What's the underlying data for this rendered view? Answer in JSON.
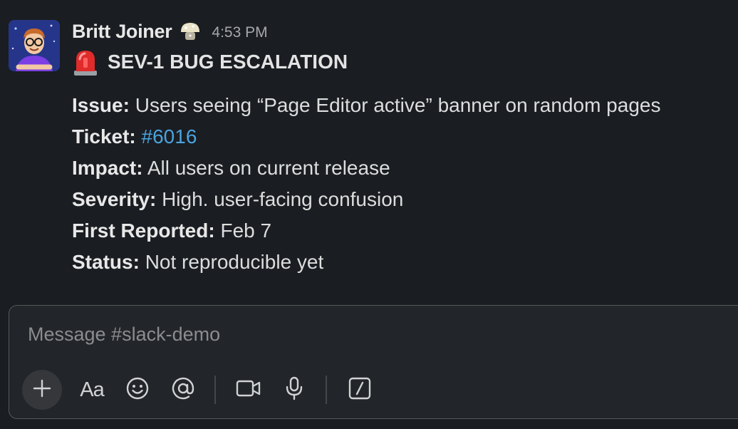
{
  "message": {
    "author": "Britt Joiner",
    "timestamp": "4:53 PM",
    "status_emoji": "mushroom-status-icon",
    "title_emoji": "rotating-light-icon",
    "title": "SEV-1 BUG ESCALATION",
    "details": [
      {
        "label": "Issue:",
        "value": "Users seeing “Page Editor active” banner on random pages"
      },
      {
        "label": "Ticket:",
        "value": "#6016"
      },
      {
        "label": "Impact:",
        "value": "All users on current release"
      },
      {
        "label": "Severity:",
        "value": "High. user-facing confusion"
      },
      {
        "label": "First Reported:",
        "value": "Feb 7"
      },
      {
        "label": "Status:",
        "value": "Not reproducible yet"
      }
    ]
  },
  "composer": {
    "placeholder": "Message #slack-demo",
    "value": "",
    "format_label": "Aa",
    "toolbar_icons": [
      "plus-icon",
      "format-text-icon",
      "emoji-icon",
      "mention-icon",
      "video-icon",
      "microphone-icon",
      "slash-command-icon"
    ]
  },
  "colors": {
    "background": "#1a1d21",
    "link": "#4aa3df",
    "composer_border": "#565856"
  }
}
